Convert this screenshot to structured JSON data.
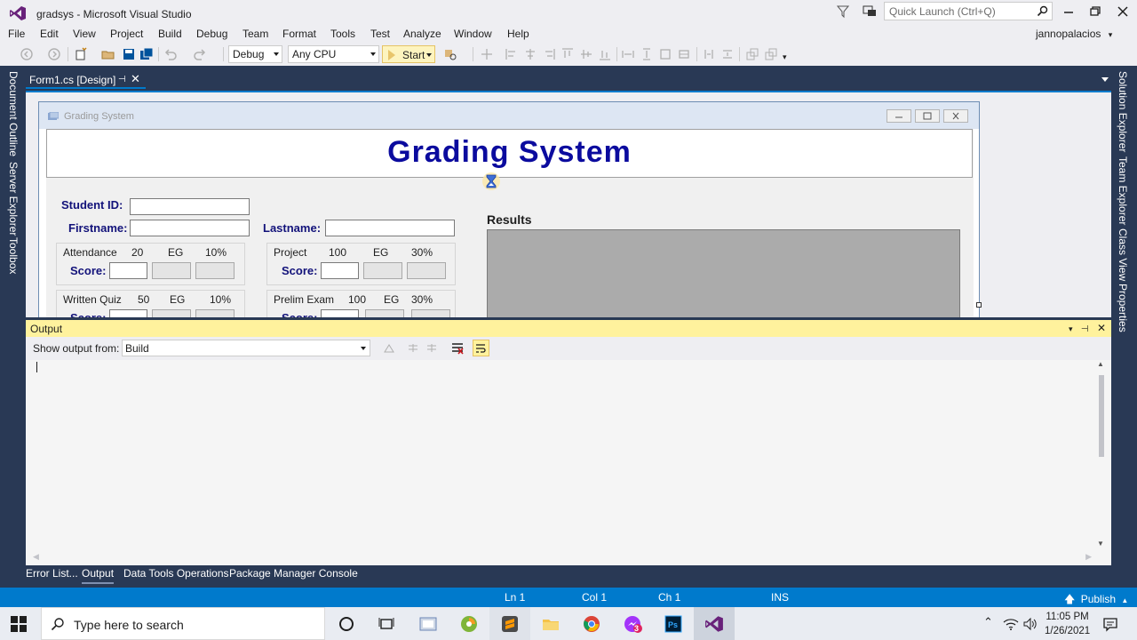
{
  "window": {
    "title": "gradsys - Microsoft Visual Studio",
    "quick_launch_placeholder": "Quick Launch (Ctrl+Q)",
    "account": "jannopalacios"
  },
  "menu": [
    "File",
    "Edit",
    "View",
    "Project",
    "Build",
    "Debug",
    "Team",
    "Format",
    "Tools",
    "Test",
    "Analyze",
    "Window",
    "Help"
  ],
  "toolbar": {
    "config": "Debug",
    "platform": "Any CPU",
    "start_label": "Start"
  },
  "left_rail": [
    "Document Outline",
    "Server Explorer",
    "Toolbox"
  ],
  "right_rail": [
    "Solution Explorer",
    "Team Explorer",
    "Class View",
    "Properties"
  ],
  "doc_tab": {
    "label": "Form1.cs [Design]"
  },
  "form": {
    "caption": "Grading System",
    "header": "Grading System",
    "student_id_label": "Student ID:",
    "firstname_label": "Firstname:",
    "lastname_label": "Lastname:",
    "results_label": "Results",
    "score_label": "Score:",
    "groups": [
      {
        "name": "Attendance",
        "items": "20",
        "eg": "EG",
        "pct": "10%"
      },
      {
        "name": "Project",
        "items": "100",
        "eg": "EG",
        "pct": "30%"
      },
      {
        "name": "Written Quiz",
        "items": "50",
        "eg": "EG",
        "pct": "10%"
      },
      {
        "name": "Prelim Exam",
        "items": "100",
        "eg": "EG",
        "pct": "30%"
      }
    ]
  },
  "output": {
    "title": "Output",
    "show_from_label": "Show output from:",
    "show_from_value": "Build"
  },
  "bottom_tabs": [
    "Error List...",
    "Output",
    "Data Tools Operations",
    "Package Manager Console"
  ],
  "status": {
    "ln": "Ln 1",
    "col": "Col 1",
    "ch": "Ch 1",
    "ins": "INS",
    "publish": "Publish"
  },
  "taskbar": {
    "search_placeholder": "Type here to search",
    "time": "11:05 PM",
    "date": "1/26/2021",
    "badge": "3"
  },
  "colors": {
    "accent": "#007acc",
    "vs_frame": "#293955",
    "output_header": "#fff29d",
    "form_title": "#0b0b9e"
  }
}
